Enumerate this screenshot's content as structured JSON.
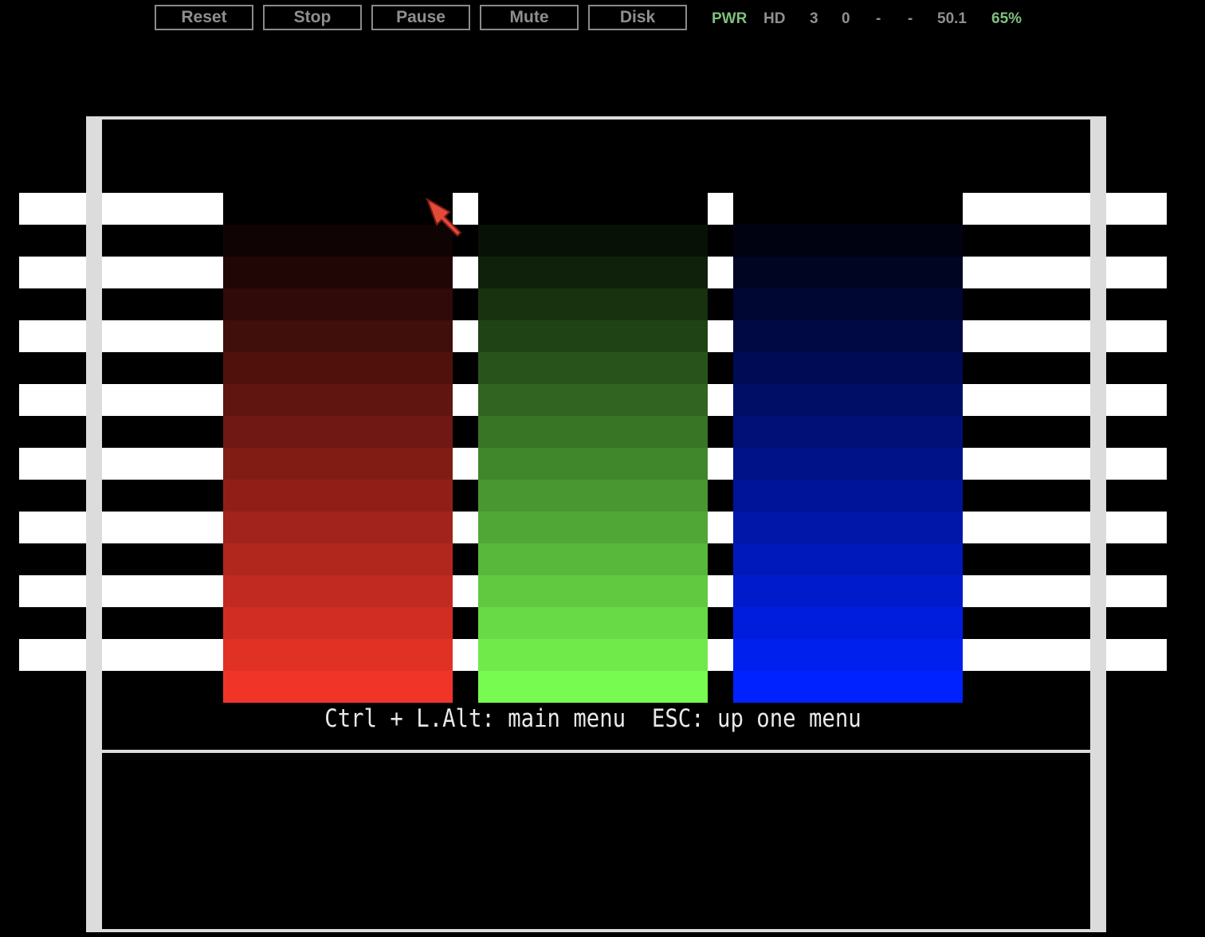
{
  "toolbar": {
    "buttons": [
      {
        "label": "Reset"
      },
      {
        "label": "Stop"
      },
      {
        "label": "Pause"
      },
      {
        "label": "Mute"
      },
      {
        "label": "Disk"
      }
    ],
    "status": {
      "pwr": "PWR",
      "hd": "HD",
      "val1": "3",
      "val2": "0",
      "val3": "-",
      "val4": "-",
      "fps": "50.1",
      "speed": "65%"
    }
  },
  "screen": {
    "hint": "Ctrl + L.Alt: main menu  ESC: up one menu",
    "colors": {
      "red_max": "#f13428",
      "green_max": "#78fb50",
      "blue_max": "#0022ff",
      "frame": "#dcdcdc",
      "status_on": "#7fc07f"
    },
    "steps": 15
  }
}
